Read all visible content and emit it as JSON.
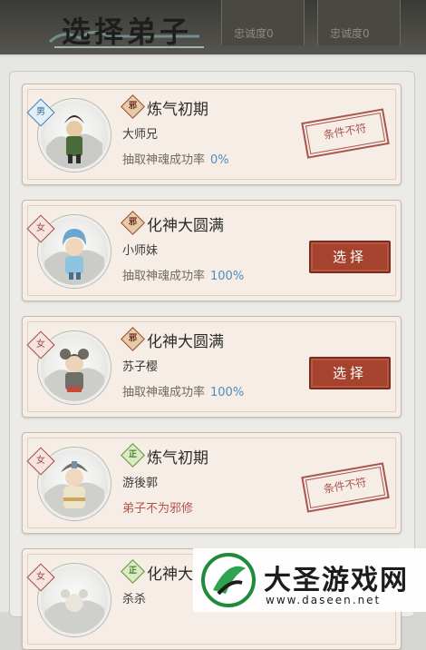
{
  "header": {
    "title": "选择弟子",
    "loyalty_1": "忠诚度0",
    "loyalty_2": "忠诚度0"
  },
  "disciples": [
    {
      "gender": "男",
      "sect": "邪",
      "realm": "炼气初期",
      "name": "大师兄",
      "rate_label": "抽取神魂成功率",
      "rate": "0%",
      "status": "stamp",
      "stamp_text": "条件不符"
    },
    {
      "gender": "女",
      "sect": "邪",
      "realm": "化神大圆满",
      "name": "小师妹",
      "rate_label": "抽取神魂成功率",
      "rate": "100%",
      "status": "button",
      "button_label": "选择"
    },
    {
      "gender": "女",
      "sect": "邪",
      "realm": "化神大圆满",
      "name": "苏子樱",
      "rate_label": "抽取神魂成功率",
      "rate": "100%",
      "status": "button",
      "button_label": "选择"
    },
    {
      "gender": "女",
      "sect": "正",
      "realm": "炼气初期",
      "name": "游後郭",
      "requirement": "弟子不为邪修",
      "status": "stamp",
      "stamp_text": "条件不符"
    },
    {
      "gender": "女",
      "sect": "正",
      "realm": "化神大",
      "name": "杀杀"
    }
  ],
  "watermark": {
    "name": "大圣游戏网",
    "url": "www.daseen.net"
  },
  "colors": {
    "button_red": "#a6432f",
    "rate_blue": "#4f8cc0",
    "card_bg": "#f5ede6"
  }
}
